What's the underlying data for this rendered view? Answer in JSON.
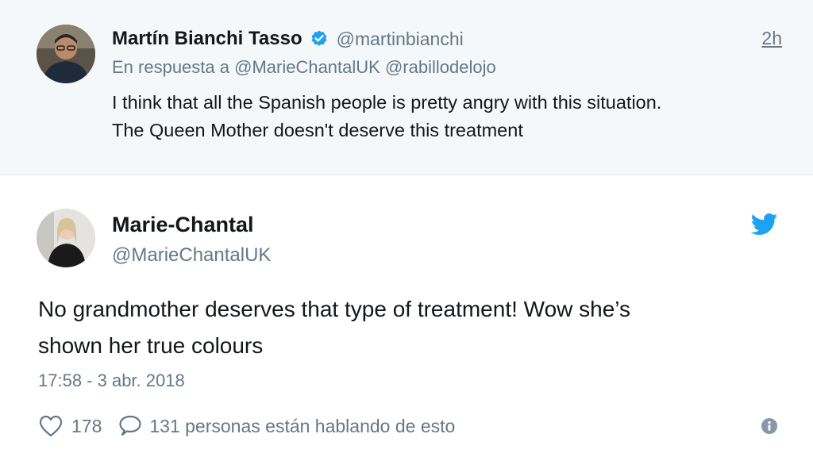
{
  "reply_tweet": {
    "author_name": "Martín Bianchi Tasso",
    "author_handle": "@martinbianchi",
    "time": "2h",
    "reply_prefix": "En respuesta a",
    "mentions": [
      "@MarieChantalUK",
      "@rabillodelojo"
    ],
    "text_line_1": "I think that all the Spanish people is pretty angry with this situation.",
    "text_line_2": "The Queen Mother doesn't deserve this treatment"
  },
  "main_tweet": {
    "author_name": "Marie-Chantal",
    "author_handle": "@MarieChantalUK",
    "text_line_1": "No grandmother deserves that type of treatment! Wow she’s",
    "text_line_2": "shown her true colours",
    "timestamp": "17:58 - 3 abr. 2018",
    "like_count": "178",
    "conversation_text": "131 personas están hablando de esto"
  },
  "icons": {
    "verified": "verified-badge-icon",
    "brand": "twitter-bird-icon",
    "like": "heart-icon",
    "reply": "speech-bubble-icon",
    "info": "info-icon"
  },
  "colors": {
    "accent": "#1da1f2",
    "text_primary": "#14171a",
    "text_secondary": "#657786",
    "reply_background": "#f5f8fa"
  }
}
